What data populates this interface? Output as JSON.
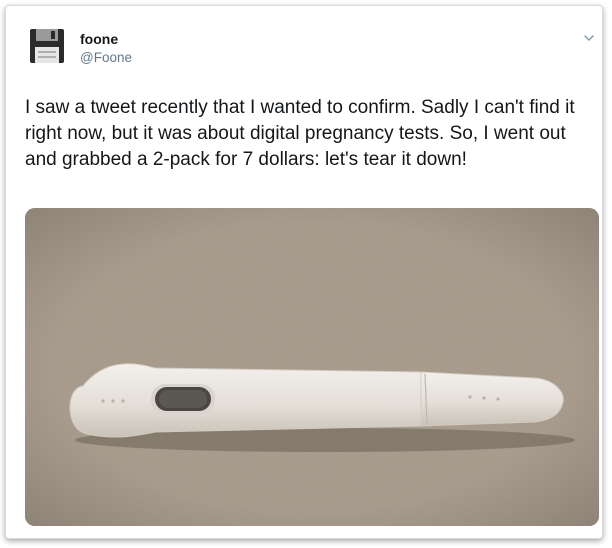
{
  "author": {
    "display_name": "foone",
    "handle": "@Foone",
    "avatar_icon": "floppy-disk-icon"
  },
  "menu": {
    "icon": "chevron-down-icon"
  },
  "tweet": {
    "text": "I saw a tweet recently that I wanted to confirm. Sadly I can't find it right now, but it was about digital pregnancy tests. So, I went out and grabbed a 2-pack for 7 dollars: let's tear it down!"
  },
  "media": {
    "subject_icon": "pregnancy-test-photo",
    "background_color": "#a39686",
    "device_color": "#ebe7e1"
  }
}
